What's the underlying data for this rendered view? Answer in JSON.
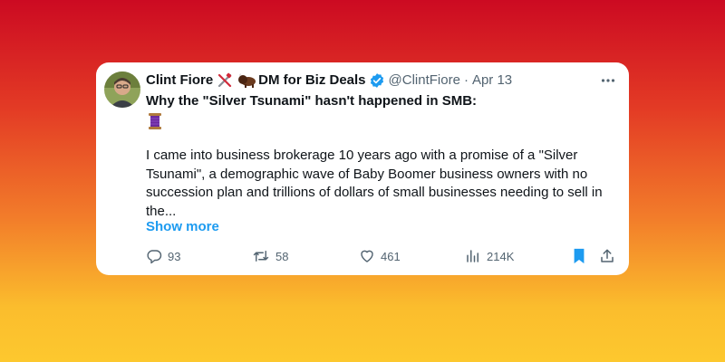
{
  "tweet": {
    "author_name": "Clint Fiore",
    "author_suffix": "DM for Biz Deals",
    "handle": "@ClintFiore",
    "separator": "·",
    "date": "Apr 13",
    "headline": "Why the \"Silver Tsunami\" hasn't happened in SMB:",
    "body": "I came into business brokerage 10 years ago with a promise of a \"Silver Tsunami\", a demographic wave of Baby Boomer business owners with no succession plan and trillions of dollars of small businesses needing to sell in the...",
    "show_more": "Show more"
  },
  "actions": {
    "replies": "93",
    "reposts": "58",
    "likes": "461",
    "views": "214K"
  },
  "icons": {
    "name_emoji_1": "crossed-tools-icon",
    "name_emoji_2": "bison-icon",
    "verified": "verified-badge-icon",
    "thread": "spool-icon",
    "more": "more-horizontal-icon",
    "reply": "reply-icon",
    "repost": "repost-icon",
    "like": "heart-icon",
    "views": "views-icon",
    "bookmark": "bookmark-icon",
    "share": "share-icon"
  },
  "colors": {
    "accent": "#1d9bf0",
    "text": "#0f1419",
    "muted": "#536471",
    "gradient_top": "#cc0a22",
    "gradient_bottom": "#fdc82e"
  }
}
